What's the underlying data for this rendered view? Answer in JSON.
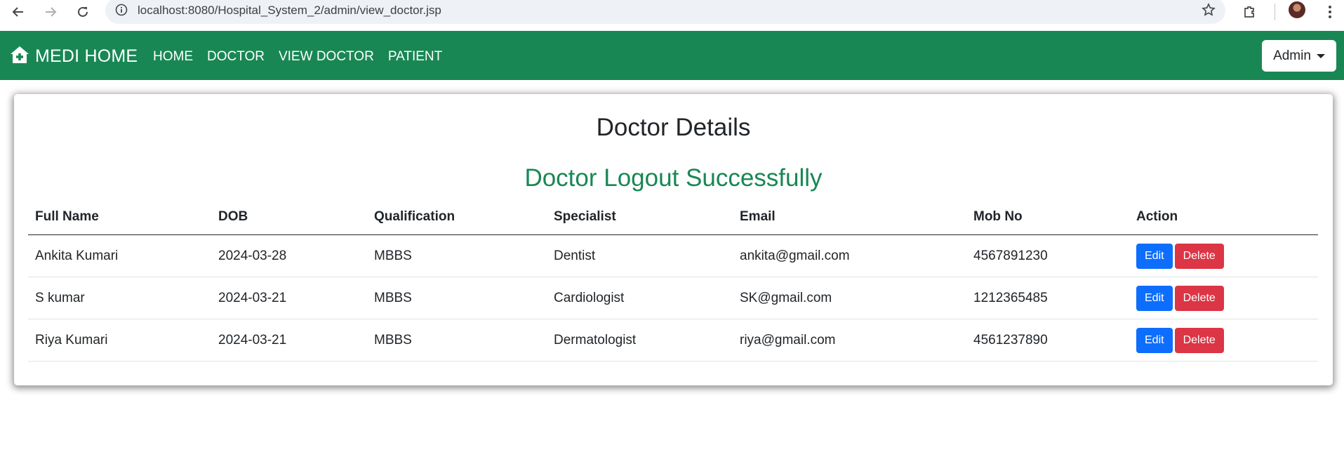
{
  "browser": {
    "url": "localhost:8080/Hospital_System_2/admin/view_doctor.jsp"
  },
  "navbar": {
    "brand": "MEDI HOME",
    "links": [
      "HOME",
      "DOCTOR",
      "VIEW DOCTOR",
      "PATIENT"
    ],
    "admin_label": "Admin",
    "color": "#198754"
  },
  "page": {
    "title": "Doctor Details",
    "message": "Doctor Logout Successfully"
  },
  "table": {
    "headers": [
      "Full Name",
      "DOB",
      "Qualification",
      "Specialist",
      "Email",
      "Mob No",
      "Action"
    ],
    "rows": [
      {
        "name": "Ankita Kumari",
        "dob": "2024-03-28",
        "qualification": "MBBS",
        "specialist": "Dentist",
        "email": "ankita@gmail.com",
        "mobile": "4567891230"
      },
      {
        "name": "S kumar",
        "dob": "2024-03-21",
        "qualification": "MBBS",
        "specialist": "Cardiologist",
        "email": "SK@gmail.com",
        "mobile": "1212365485"
      },
      {
        "name": "Riya Kumari",
        "dob": "2024-03-21",
        "qualification": "MBBS",
        "specialist": "Dermatologist",
        "email": "riya@gmail.com",
        "mobile": "4561237890"
      }
    ],
    "edit_label": "Edit",
    "delete_label": "Delete"
  }
}
